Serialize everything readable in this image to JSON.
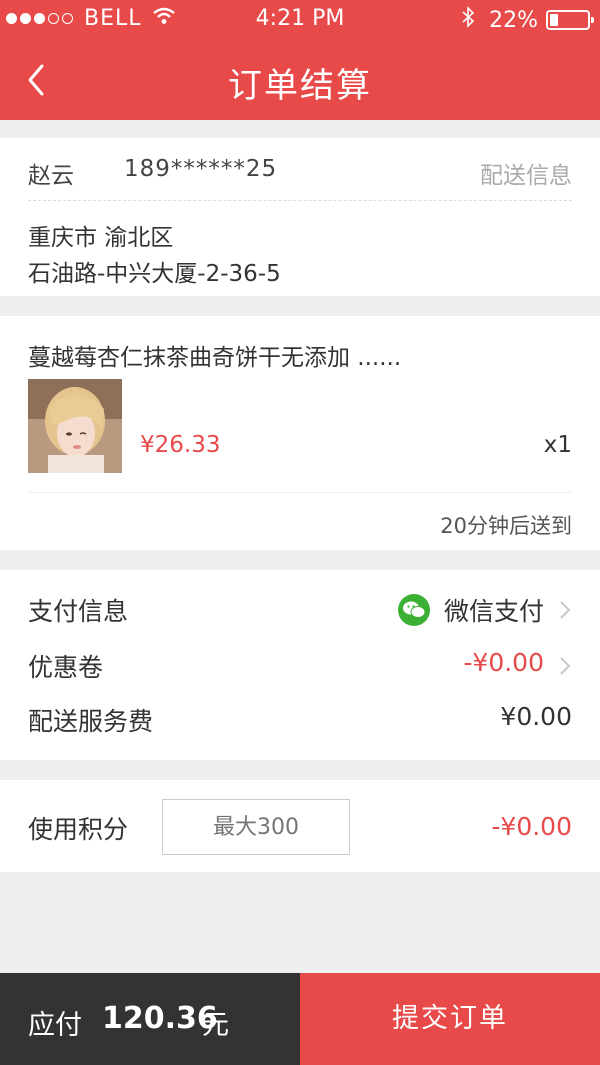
{
  "status_bar": {
    "carrier": "BELL",
    "time": "4:21 PM",
    "battery": "22%",
    "battery_level": 0.22
  },
  "header": {
    "title": "订单结算",
    "back_icon": "chevron-left-icon"
  },
  "address": {
    "name": "赵云",
    "phone": "189******25",
    "shipping_label": "配送信息",
    "line1": "重庆市 渝北区",
    "line2": "石油路-中兴大厦-2-36-5"
  },
  "product": {
    "name": "蔓越莓杏仁抹茶曲奇饼干无添加 ......",
    "price": "¥26.33",
    "quantity": "x1",
    "eta": "20分钟后送到"
  },
  "payment": {
    "pay_info_label": "支付信息",
    "pay_method": "微信支付",
    "coupon_label": "优惠卷",
    "coupon_value": "-¥0.00",
    "delivery_fee_label": "配送服务费",
    "delivery_fee_value": "¥0.00"
  },
  "points": {
    "label": "使用积分",
    "placeholder": "最大300",
    "deduction": "-¥0.00"
  },
  "footer": {
    "total_label": "应付",
    "total_amount": "120.36",
    "unit": "元",
    "submit_label": "提交订单"
  },
  "colors": {
    "brand_red": "#e84a4a",
    "wechat_green": "#3cb034",
    "footer_dark": "#333333"
  }
}
